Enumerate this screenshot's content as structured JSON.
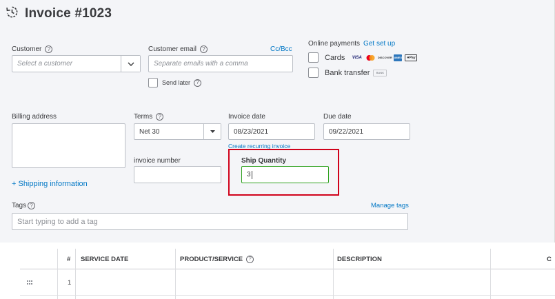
{
  "header": {
    "title": "Invoice #1023",
    "icon": "recurring-clock-icon"
  },
  "customer": {
    "label": "Customer",
    "placeholder": "Select a customer"
  },
  "customer_email": {
    "label": "Customer email",
    "placeholder": "Separate emails with a comma",
    "cc_bcc": "Cc/Bcc"
  },
  "send_later": {
    "label": "Send later"
  },
  "online_payments": {
    "label": "Online payments",
    "setup_link": "Get set up",
    "cards_label": "Cards",
    "card_brands": [
      "VISA",
      "MC",
      "DISCOVER",
      "AMEX",
      "Pay"
    ],
    "bank_label": "Bank transfer",
    "bank_badge": "BANK"
  },
  "billing": {
    "label": "Billing address"
  },
  "terms": {
    "label": "Terms",
    "value": "Net 30"
  },
  "invoice_date": {
    "label": "Invoice date",
    "value": "08/23/2021"
  },
  "due_date": {
    "label": "Due date",
    "value": "09/22/2021"
  },
  "recurring_link": "Create recurring invoice",
  "invoice_number": {
    "label": "invoice number",
    "value": ""
  },
  "ship_quantity": {
    "label": "Ship Quantity",
    "value": "3"
  },
  "shipping_link": "+ Shipping information",
  "tags": {
    "label": "Tags",
    "manage_link": "Manage tags",
    "placeholder": "Start typing to add a tag"
  },
  "table": {
    "headers": {
      "num": "#",
      "service_date": "SERVICE DATE",
      "product": "PRODUCT/SERVICE",
      "description": "DESCRIPTION",
      "qty": "C"
    },
    "rows": [
      {
        "num": "1"
      }
    ]
  },
  "colors": {
    "link": "#0077c5",
    "highlight": "#d0021b",
    "focus_border": "#2ca01c",
    "background": "#f4f5f8"
  }
}
